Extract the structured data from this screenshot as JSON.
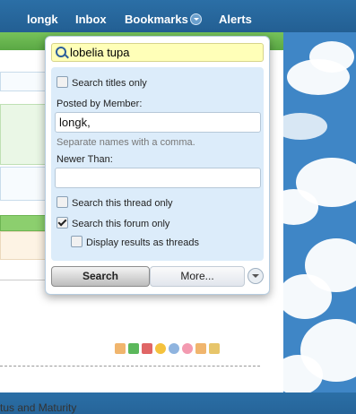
{
  "nav": {
    "items": [
      {
        "label": "longk"
      },
      {
        "label": "Inbox"
      },
      {
        "label": "Bookmarks"
      },
      {
        "label": "Alerts"
      }
    ]
  },
  "search_popup": {
    "keywords_value": "lobelia tupa",
    "titles_only_label": "Search titles only",
    "titles_only_checked": false,
    "posted_by_label": "Posted by Member:",
    "posted_by_value": "longk,",
    "posted_by_hint": "Separate names with a comma.",
    "newer_than_label": "Newer Than:",
    "newer_than_value": "",
    "this_thread_label": "Search this thread only",
    "this_thread_checked": false,
    "this_forum_label": "Search this forum only",
    "this_forum_checked": true,
    "as_threads_label": "Display results as threads",
    "as_threads_checked": false,
    "search_button": "Search",
    "more_button": "More..."
  },
  "background_page": {
    "bottom_text": "tus and Maturity"
  },
  "colors": {
    "nav_background": "#235f93",
    "popup_panel": "#dcecfa",
    "keywords_field": "#ffffb8",
    "green_bar": "#5aa844"
  },
  "icons": [
    "search-icon",
    "chevron-down-icon",
    "like-icon",
    "check-icon",
    "cross-icon",
    "smile-icon",
    "info-icon",
    "heart-icon",
    "wrench-icon",
    "brush-icon"
  ]
}
